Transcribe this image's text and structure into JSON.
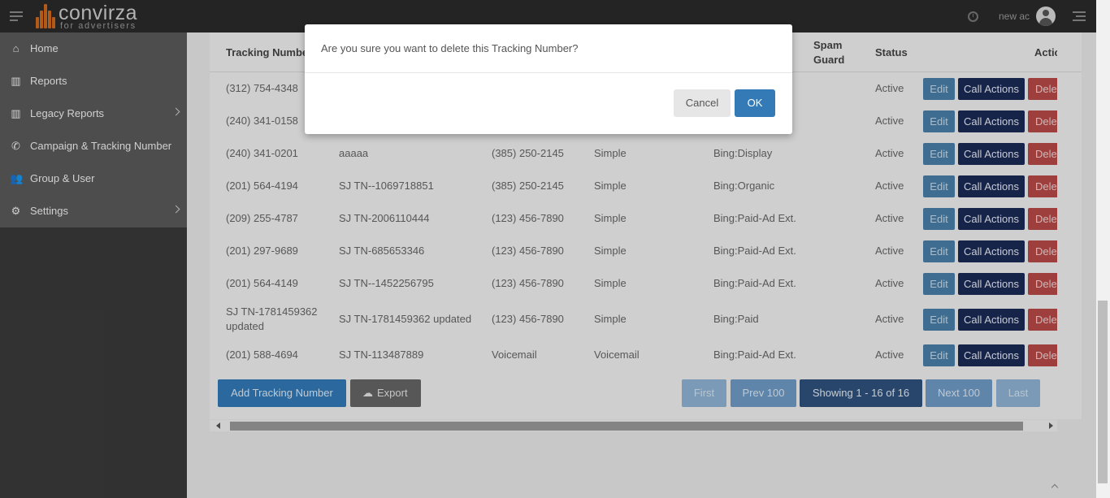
{
  "header": {
    "brand": "convirza",
    "brand_sub": "for advertisers",
    "user_name": "new ac"
  },
  "sidebar": {
    "items": [
      {
        "label": "Home",
        "icon": "home-icon",
        "glyph": "⌂",
        "has_submenu": false
      },
      {
        "label": "Reports",
        "icon": "bar-chart-icon",
        "glyph": "▥",
        "has_submenu": false
      },
      {
        "label": "Legacy Reports",
        "icon": "bar-chart-icon",
        "glyph": "▥",
        "has_submenu": true
      },
      {
        "label": "Campaign & Tracking Number",
        "icon": "phone-icon",
        "glyph": "✆",
        "has_submenu": false
      },
      {
        "label": "Group & User",
        "icon": "users-icon",
        "glyph": "👥",
        "has_submenu": false
      },
      {
        "label": "Settings",
        "icon": "gear-icon",
        "glyph": "⚙",
        "has_submenu": true
      }
    ]
  },
  "table": {
    "headers": {
      "tracking_number": "Tracking Number",
      "spam_guard_1": "Spam",
      "spam_guard_2": "Guard",
      "status": "Status",
      "actions": "Actions"
    },
    "buttons": {
      "edit": "Edit",
      "call_actions": "Call Actions",
      "delete": "Delete"
    },
    "rows": [
      {
        "number": "(312) 754-4348",
        "name": "",
        "ring_to": "",
        "type": "",
        "source": "",
        "status": "Active"
      },
      {
        "number": "(240) 341-0158",
        "name": "",
        "ring_to": "",
        "type": "",
        "source": "",
        "status": "Active"
      },
      {
        "number": "(240) 341-0201",
        "name": "aaaaa",
        "ring_to": "(385) 250-2145",
        "type": "Simple",
        "source": "Bing:Display",
        "status": "Active"
      },
      {
        "number": "(201) 564-4194",
        "name": "SJ TN--1069718851",
        "ring_to": "(385) 250-2145",
        "type": "Simple",
        "source": "Bing:Organic",
        "status": "Active"
      },
      {
        "number": "(209) 255-4787",
        "name": "SJ TN-2006110444",
        "ring_to": "(123) 456-7890",
        "type": "Simple",
        "source": "Bing:Paid-Ad Ext.",
        "status": "Active"
      },
      {
        "number": "(201) 297-9689",
        "name": "SJ TN-685653346",
        "ring_to": "(123) 456-7890",
        "type": "Simple",
        "source": "Bing:Paid-Ad Ext.",
        "status": "Active"
      },
      {
        "number": "(201) 564-4149",
        "name": "SJ TN--1452256795",
        "ring_to": "(123) 456-7890",
        "type": "Simple",
        "source": "Bing:Paid-Ad Ext.",
        "status": "Active"
      },
      {
        "number": "SJ TN-1781459362 updated",
        "number_line1": "SJ TN-1781459362",
        "number_line2": "updated",
        "name": "SJ TN-1781459362 updated",
        "ring_to": "(123) 456-7890",
        "type": "Simple",
        "source": "Bing:Paid",
        "status": "Active"
      },
      {
        "number": "(201) 588-4694",
        "name": "SJ TN-113487889",
        "ring_to": "Voicemail",
        "type": "Voicemail",
        "source": "Bing:Paid-Ad Ext.",
        "status": "Active"
      }
    ]
  },
  "footer": {
    "add_label": "Add Tracking Number",
    "export_label": "Export",
    "pagination": {
      "first": "First",
      "prev": "Prev 100",
      "showing": "Showing 1 - 16 of 16",
      "next": "Next 100",
      "last": "Last"
    }
  },
  "modal": {
    "message": "Are you sure you want to delete this Tracking Number?",
    "cancel_label": "Cancel",
    "ok_label": "OK"
  },
  "colors": {
    "brand_orange": "#d2691e",
    "primary_blue": "#337ab7",
    "navy": "#1a2b57",
    "danger_red": "#b84a47"
  }
}
